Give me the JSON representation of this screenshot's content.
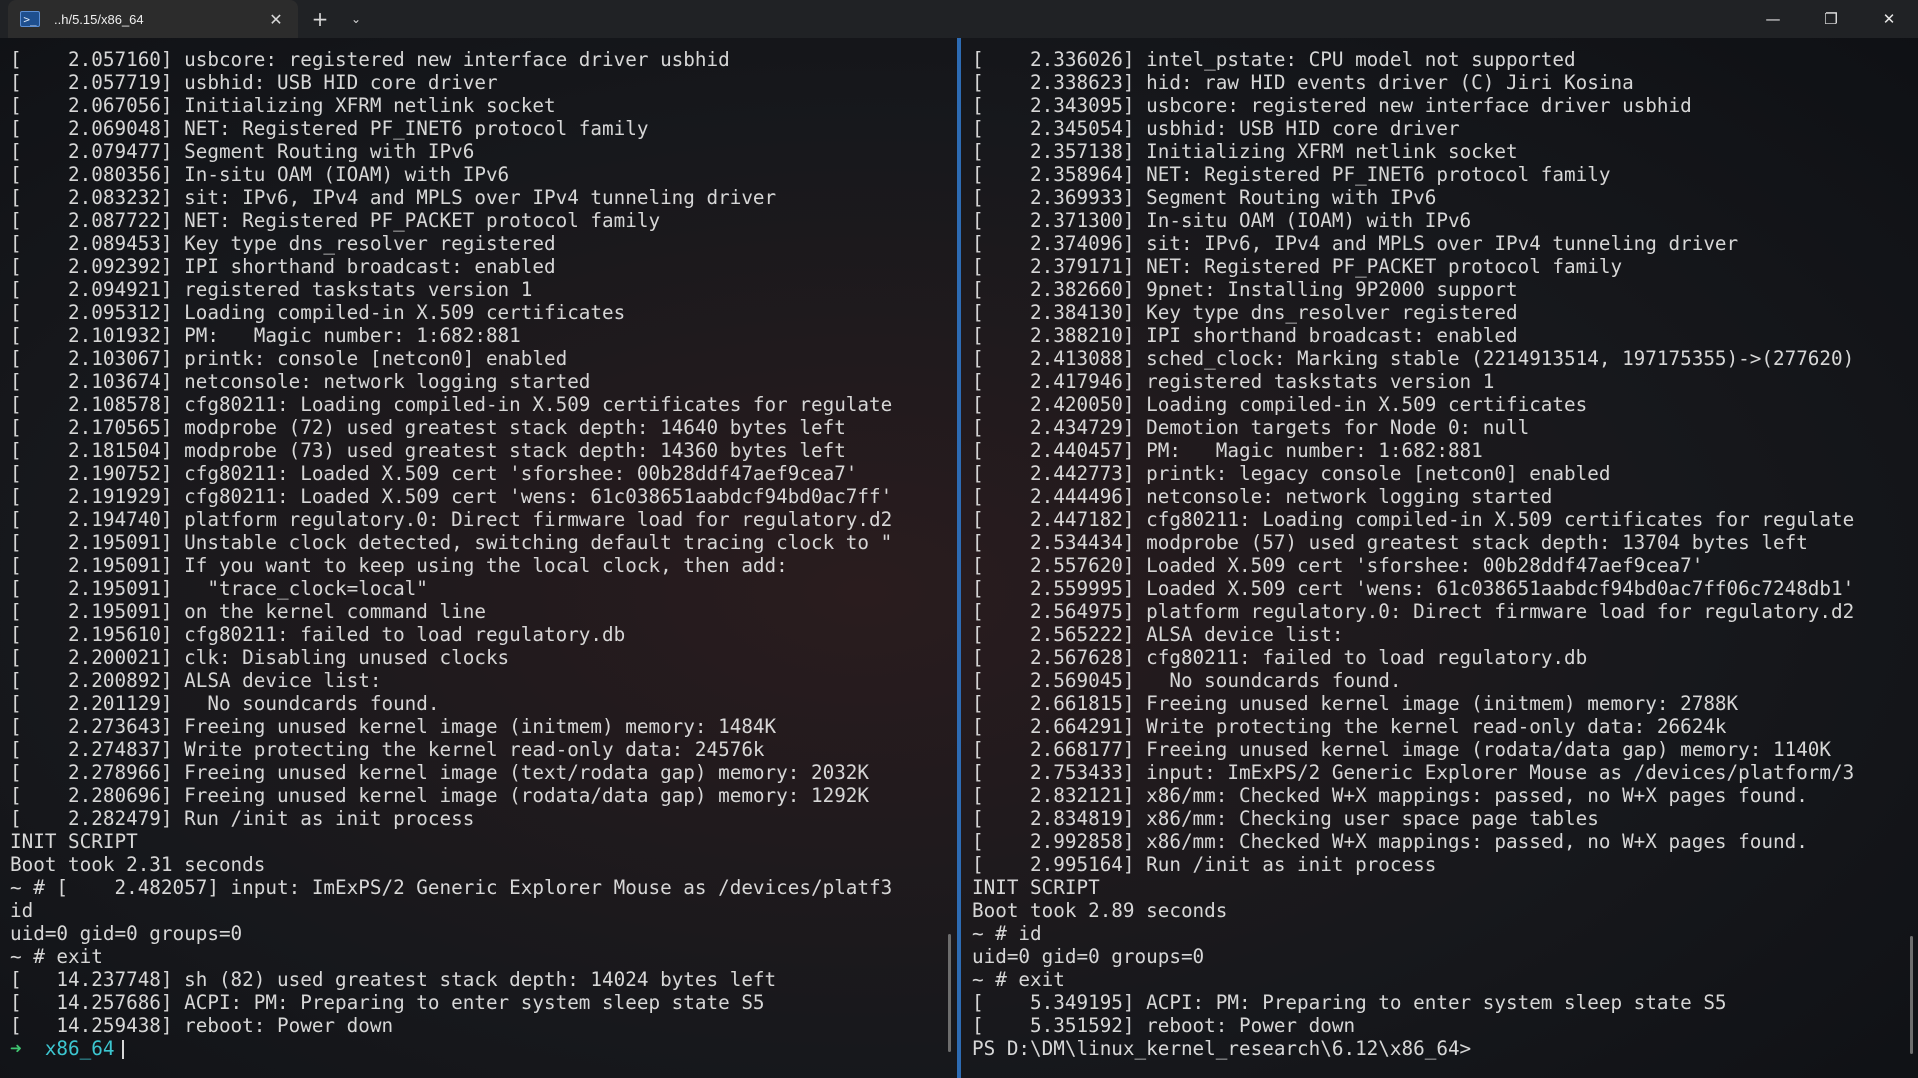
{
  "tab": {
    "icon_glyph": ">_",
    "title": "..h/5.15/x86_64",
    "close_glyph": "✕",
    "new_tab_glyph": "+",
    "dropdown_glyph": "⌄"
  },
  "window_controls": {
    "minimize": "—",
    "maximize": "❐",
    "close": "✕"
  },
  "left_pane": {
    "lines": [
      "[    2.057160] usbcore: registered new interface driver usbhid",
      "[    2.057719] usbhid: USB HID core driver",
      "[    2.067056] Initializing XFRM netlink socket",
      "[    2.069048] NET: Registered PF_INET6 protocol family",
      "[    2.079477] Segment Routing with IPv6",
      "[    2.080356] In-situ OAM (IOAM) with IPv6",
      "[    2.083232] sit: IPv6, IPv4 and MPLS over IPv4 tunneling driver",
      "[    2.087722] NET: Registered PF_PACKET protocol family",
      "[    2.089453] Key type dns_resolver registered",
      "[    2.092392] IPI shorthand broadcast: enabled",
      "[    2.094921] registered taskstats version 1",
      "[    2.095312] Loading compiled-in X.509 certificates",
      "[    2.101932] PM:   Magic number: 1:682:881",
      "[    2.103067] printk: console [netcon0] enabled",
      "[    2.103674] netconsole: network logging started",
      "[    2.108578] cfg80211: Loading compiled-in X.509 certificates for regulate",
      "[    2.170565] modprobe (72) used greatest stack depth: 14640 bytes left",
      "[    2.181504] modprobe (73) used greatest stack depth: 14360 bytes left",
      "[    2.190752] cfg80211: Loaded X.509 cert 'sforshee: 00b28ddf47aef9cea7'",
      "[    2.191929] cfg80211: Loaded X.509 cert 'wens: 61c038651aabdcf94bd0ac7ff'",
      "[    2.194740] platform regulatory.0: Direct firmware load for regulatory.d2",
      "[    2.195091] Unstable clock detected, switching default tracing clock to \"",
      "[    2.195091] If you want to keep using the local clock, then add:",
      "[    2.195091]   \"trace_clock=local\"",
      "[    2.195091] on the kernel command line",
      "[    2.195610] cfg80211: failed to load regulatory.db",
      "[    2.200021] clk: Disabling unused clocks",
      "[    2.200892] ALSA device list:",
      "[    2.201129]   No soundcards found.",
      "[    2.273643] Freeing unused kernel image (initmem) memory: 1484K",
      "[    2.274837] Write protecting the kernel read-only data: 24576k",
      "[    2.278966] Freeing unused kernel image (text/rodata gap) memory: 2032K",
      "[    2.280696] Freeing unused kernel image (rodata/data gap) memory: 1292K",
      "[    2.282479] Run /init as init process",
      "INIT SCRIPT",
      "Boot took 2.31 seconds",
      "~ # [    2.482057] input: ImExPS/2 Generic Explorer Mouse as /devices/platf3",
      "id",
      "uid=0 gid=0 groups=0",
      "~ # exit",
      "[   14.237748] sh (82) used greatest stack depth: 14024 bytes left",
      "[   14.257686] ACPI: PM: Preparing to enter system sleep state S5",
      "[   14.259438] reboot: Power down"
    ],
    "prompt_arrow": "➜",
    "prompt_dir": "x86_64"
  },
  "right_pane": {
    "lines": [
      "[    2.336026] intel_pstate: CPU model not supported",
      "[    2.338623] hid: raw HID events driver (C) Jiri Kosina",
      "[    2.343095] usbcore: registered new interface driver usbhid",
      "[    2.345054] usbhid: USB HID core driver",
      "[    2.357138] Initializing XFRM netlink socket",
      "[    2.358964] NET: Registered PF_INET6 protocol family",
      "[    2.369933] Segment Routing with IPv6",
      "[    2.371300] In-situ OAM (IOAM) with IPv6",
      "[    2.374096] sit: IPv6, IPv4 and MPLS over IPv4 tunneling driver",
      "[    2.379171] NET: Registered PF_PACKET protocol family",
      "[    2.382660] 9pnet: Installing 9P2000 support",
      "[    2.384130] Key type dns_resolver registered",
      "[    2.388210] IPI shorthand broadcast: enabled",
      "[    2.413088] sched_clock: Marking stable (2214913514, 197175355)->(277620)",
      "[    2.417946] registered taskstats version 1",
      "[    2.420050] Loading compiled-in X.509 certificates",
      "[    2.434729] Demotion targets for Node 0: null",
      "[    2.440457] PM:   Magic number: 1:682:881",
      "[    2.442773] printk: legacy console [netcon0] enabled",
      "[    2.444496] netconsole: network logging started",
      "[    2.447182] cfg80211: Loading compiled-in X.509 certificates for regulate",
      "[    2.534434] modprobe (57) used greatest stack depth: 13704 bytes left",
      "[    2.557620] Loaded X.509 cert 'sforshee: 00b28ddf47aef9cea7'",
      "[    2.559995] Loaded X.509 cert 'wens: 61c038651aabdcf94bd0ac7ff06c7248db1'",
      "[    2.564975] platform regulatory.0: Direct firmware load for regulatory.d2",
      "[    2.565222] ALSA device list:",
      "[    2.567628] cfg80211: failed to load regulatory.db",
      "[    2.569045]   No soundcards found.",
      "[    2.661815] Freeing unused kernel image (initmem) memory: 2788K",
      "[    2.664291] Write protecting the kernel read-only data: 26624k",
      "[    2.668177] Freeing unused kernel image (rodata/data gap) memory: 1140K",
      "[    2.753433] input: ImExPS/2 Generic Explorer Mouse as /devices/platform/3",
      "[    2.832121] x86/mm: Checked W+X mappings: passed, no W+X pages found.",
      "[    2.834819] x86/mm: Checking user space page tables",
      "[    2.992858] x86/mm: Checked W+X mappings: passed, no W+X pages found.",
      "[    2.995164] Run /init as init process",
      "INIT SCRIPT",
      "Boot took 2.89 seconds",
      "~ # id",
      "uid=0 gid=0 groups=0",
      "~ # exit",
      "[    5.349195] ACPI: PM: Preparing to enter system sleep state S5",
      "[    5.351592] reboot: Power down",
      "PS D:\\DM\\linux_kernel_research\\6.12\\x86_64>"
    ]
  }
}
